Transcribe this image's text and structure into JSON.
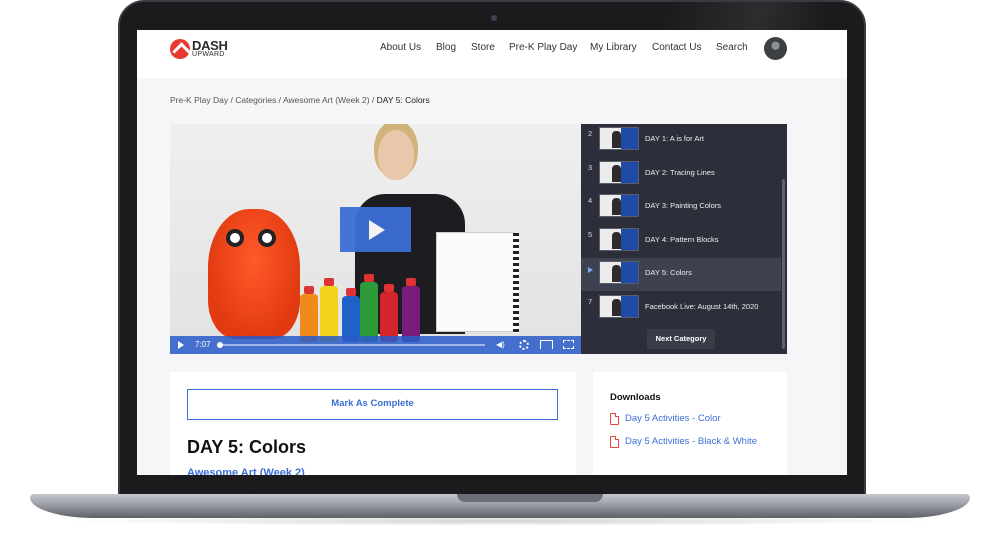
{
  "site": {
    "logo_top": "DASH",
    "logo_bottom": "UPWARD"
  },
  "nav": {
    "items": [
      "About Us",
      "Blog",
      "Store",
      "Pre-K Play Day",
      "My Library",
      "Contact Us",
      "Search"
    ]
  },
  "breadcrumb": {
    "items": [
      "Pre-K Play Day",
      "Categories",
      "Awesome Art (Week 2)"
    ],
    "separator": " / ",
    "current": "DAY 5: Colors"
  },
  "video": {
    "time": "7:07"
  },
  "playlist": {
    "items": [
      {
        "num": "2",
        "title": "DAY 1: A is for Art"
      },
      {
        "num": "3",
        "title": "DAY 2: Tracing Lines"
      },
      {
        "num": "4",
        "title": "DAY 3: Painting Colors"
      },
      {
        "num": "5",
        "title": "DAY 4: Pattern Blocks"
      },
      {
        "num": "",
        "title": "DAY 5: Colors"
      },
      {
        "num": "7",
        "title": "Facebook Live: August 14th, 2020"
      }
    ],
    "next_label": "Next Category"
  },
  "lesson": {
    "mark_complete": "Mark As Complete",
    "title": "DAY 5: Colors",
    "category": "Awesome Art (Week 2)"
  },
  "downloads": {
    "heading": "Downloads",
    "items": [
      "Day 5 Activities - Color",
      "Day 5 Activities - Black & White"
    ]
  },
  "colors": {
    "accent": "#3b6fd6",
    "logo_red": "#e63930",
    "playlist_bg": "#2c2f39",
    "pdf_red": "#e5483a"
  }
}
